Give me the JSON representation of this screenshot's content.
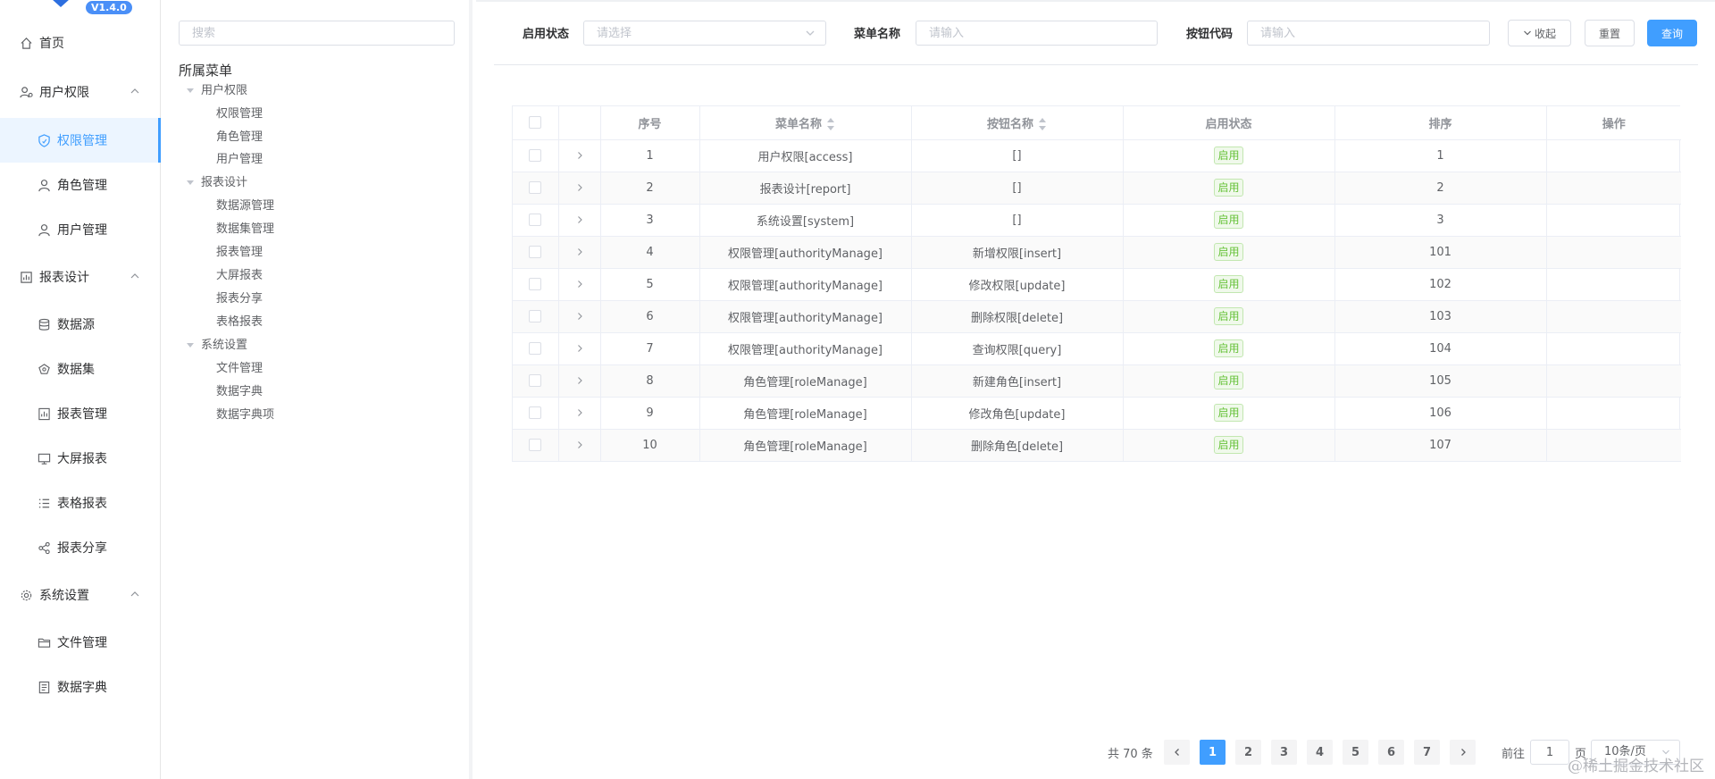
{
  "app": {
    "version": "V1.4.0"
  },
  "nav": {
    "home": "首页",
    "user_perm": "用户权限",
    "perm_manage": "权限管理",
    "role_manage": "角色管理",
    "user_manage": "用户管理",
    "report_design": "报表设计",
    "datasource": "数据源",
    "dataset": "数据集",
    "report_manage": "报表管理",
    "bigscreen": "大屏报表",
    "excel_report": "表格报表",
    "report_share": "报表分享",
    "system": "系统设置",
    "file_manage": "文件管理",
    "dict": "数据字典"
  },
  "tree": {
    "search_placeholder": "搜索",
    "title": "所属菜单",
    "groups": [
      {
        "label": "用户权限",
        "children": [
          "权限管理",
          "角色管理",
          "用户管理"
        ]
      },
      {
        "label": "报表设计",
        "children": [
          "数据源管理",
          "数据集管理",
          "报表管理",
          "大屏报表",
          "报表分享",
          "表格报表"
        ]
      },
      {
        "label": "系统设置",
        "children": [
          "文件管理",
          "数据字典",
          "数据字典项"
        ]
      }
    ]
  },
  "filters": {
    "status_label": "启用状态",
    "status_placeholder": "请选择",
    "menu_label": "菜单名称",
    "menu_placeholder": "请输入",
    "code_label": "按钮代码",
    "code_placeholder": "请输入",
    "collapse_btn": "收起",
    "reset_btn": "重置",
    "query_btn": "查询"
  },
  "table": {
    "headers": {
      "index": "序号",
      "menu_name": "菜单名称",
      "button_name": "按钮名称",
      "status": "启用状态",
      "sort": "排序",
      "action": "操作"
    },
    "rows": [
      {
        "index": "1",
        "menu": "用户权限[access]",
        "button": "[]",
        "status": "启用",
        "sort": "1"
      },
      {
        "index": "2",
        "menu": "报表设计[report]",
        "button": "[]",
        "status": "启用",
        "sort": "2"
      },
      {
        "index": "3",
        "menu": "系统设置[system]",
        "button": "[]",
        "status": "启用",
        "sort": "3"
      },
      {
        "index": "4",
        "menu": "权限管理[authorityManage]",
        "button": "新增权限[insert]",
        "status": "启用",
        "sort": "101"
      },
      {
        "index": "5",
        "menu": "权限管理[authorityManage]",
        "button": "修改权限[update]",
        "status": "启用",
        "sort": "102"
      },
      {
        "index": "6",
        "menu": "权限管理[authorityManage]",
        "button": "删除权限[delete]",
        "status": "启用",
        "sort": "103"
      },
      {
        "index": "7",
        "menu": "权限管理[authorityManage]",
        "button": "查询权限[query]",
        "status": "启用",
        "sort": "104"
      },
      {
        "index": "8",
        "menu": "角色管理[roleManage]",
        "button": "新建角色[insert]",
        "status": "启用",
        "sort": "105"
      },
      {
        "index": "9",
        "menu": "角色管理[roleManage]",
        "button": "修改角色[update]",
        "status": "启用",
        "sort": "106"
      },
      {
        "index": "10",
        "menu": "角色管理[roleManage]",
        "button": "删除角色[delete]",
        "status": "启用",
        "sort": "107"
      }
    ]
  },
  "pagination": {
    "total": "共 70 条",
    "pages": [
      "1",
      "2",
      "3",
      "4",
      "5",
      "6",
      "7"
    ],
    "current": "1",
    "goto_label": "前往",
    "goto_value": "1",
    "page_suffix": "页",
    "page_size": "10条/页"
  },
  "watermark": "@稀土掘金技术社区",
  "colors": {
    "primary": "#409eff",
    "success": "#67c23a"
  }
}
